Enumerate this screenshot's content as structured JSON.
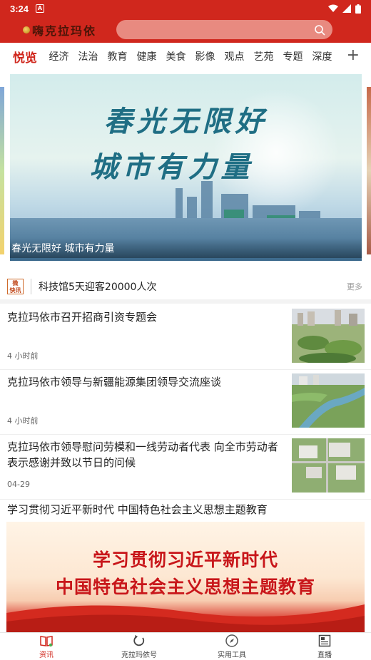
{
  "status_bar": {
    "time": "3:24",
    "notification_letter": "A"
  },
  "header": {
    "app_name": "嗨克拉玛依",
    "search_placeholder": ""
  },
  "tabs": [
    "悦览",
    "经济",
    "法治",
    "教育",
    "健康",
    "美食",
    "影像",
    "观点",
    "艺苑",
    "专题",
    "深度"
  ],
  "banner": {
    "headline_line1": "春光无限好",
    "headline_line2": "城市有力量",
    "caption": "春光无限好  城市有力量"
  },
  "ticker": {
    "badge_line1": "微",
    "badge_line2": "快讯",
    "text": "科技馆5天迎客20000人次",
    "more": "更多"
  },
  "news": [
    {
      "title": "克拉玛依市召开招商引资专题会",
      "time": "4 小时前"
    },
    {
      "title": "克拉玛依市领导与新疆能源集团领导交流座谈",
      "time": "4 小时前"
    },
    {
      "title": "克拉玛依市领导慰问劳模和一线劳动者代表  向全市劳动者表示感谢并致以节日的问候",
      "time": "04-29"
    }
  ],
  "promo": {
    "title": "学习贯彻习近平新时代  中国特色社会主义思想主题教育",
    "line1": "学习贯彻习近平新时代",
    "line2": "中国特色社会主义思想主题教育"
  },
  "bottom_nav": [
    {
      "label": "资讯",
      "icon": "book-icon"
    },
    {
      "label": "克拉玛依号",
      "icon": "refresh-icon"
    },
    {
      "label": "实用工具",
      "icon": "compass-icon"
    },
    {
      "label": "直播",
      "icon": "news-icon"
    }
  ],
  "colors": {
    "brand_red": "#d0271d",
    "text_dark": "#222222",
    "active_nav": "#d0271d"
  }
}
